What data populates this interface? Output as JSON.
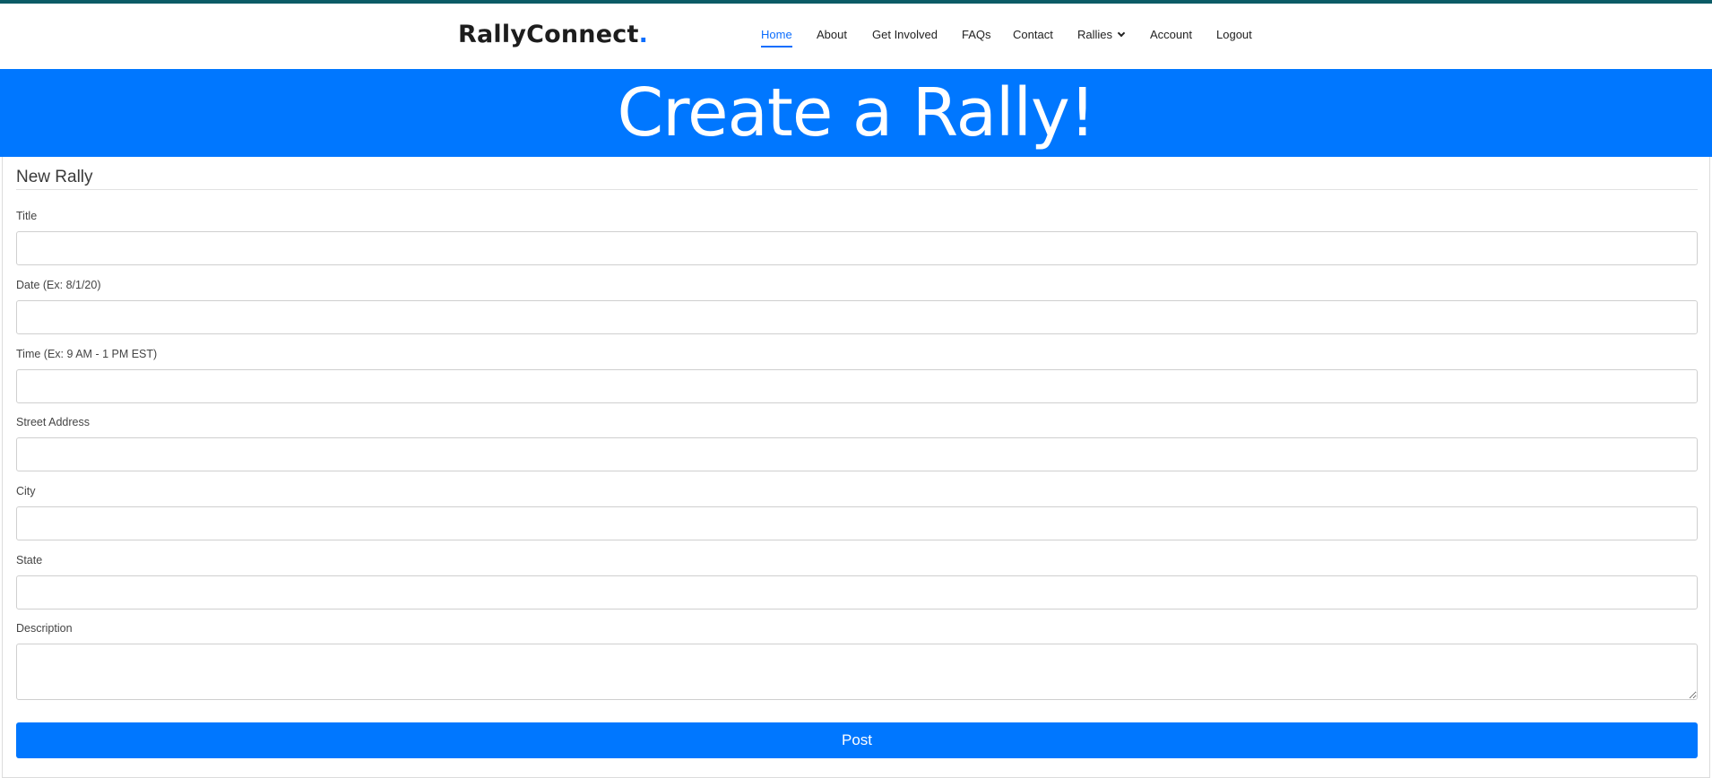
{
  "brand": {
    "name": "RallyConnect",
    "dot": "."
  },
  "nav": {
    "items": [
      {
        "label": "Home",
        "active": true
      },
      {
        "label": "About"
      },
      {
        "label": "Get Involved"
      },
      {
        "label": "FAQs"
      },
      {
        "label": "Contact"
      },
      {
        "label": "Rallies",
        "dropdown": true
      },
      {
        "label": "Account"
      },
      {
        "label": "Logout"
      }
    ]
  },
  "hero": {
    "title": "Create a Rally!"
  },
  "form": {
    "heading": "New Rally",
    "fields": [
      {
        "label": "Title",
        "value": ""
      },
      {
        "label": "Date (Ex: 8/1/20)",
        "value": ""
      },
      {
        "label": "Time (Ex: 9 AM - 1 PM EST)",
        "value": ""
      },
      {
        "label": "Street Address",
        "value": ""
      },
      {
        "label": "City",
        "value": ""
      },
      {
        "label": "State",
        "value": ""
      },
      {
        "label": "Description",
        "value": ""
      }
    ],
    "submit_label": "Post"
  },
  "colors": {
    "primary": "#0077ff",
    "nav_active": "#0d6efd",
    "top_strip": "#0b5b66"
  },
  "icons": {
    "rallies_dropdown": "chevron-down-icon"
  }
}
